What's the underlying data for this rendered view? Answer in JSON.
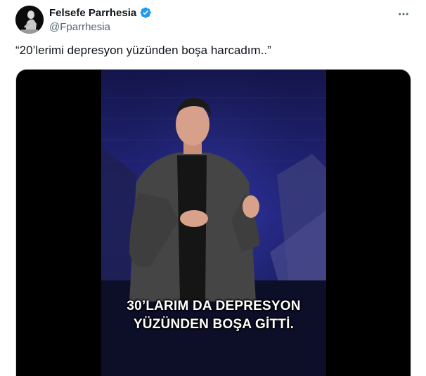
{
  "author": {
    "display_name": "Felsefe Parrhesia",
    "handle": "@Fparrhesia",
    "verified": true,
    "verified_color": "#1d9bf0",
    "avatar_icon": "figure-silhouette-icon"
  },
  "menu": {
    "icon": "more-horizontal-icon"
  },
  "tweet": {
    "text": "“20’lerimi depresyon yüzünden boşa harcadım..”"
  },
  "media": {
    "type": "video",
    "subtitle_line1": "30’LARIM DA DEPRESYON",
    "subtitle_line2": "YÜZÜNDEN BOŞA GİTTİ."
  }
}
